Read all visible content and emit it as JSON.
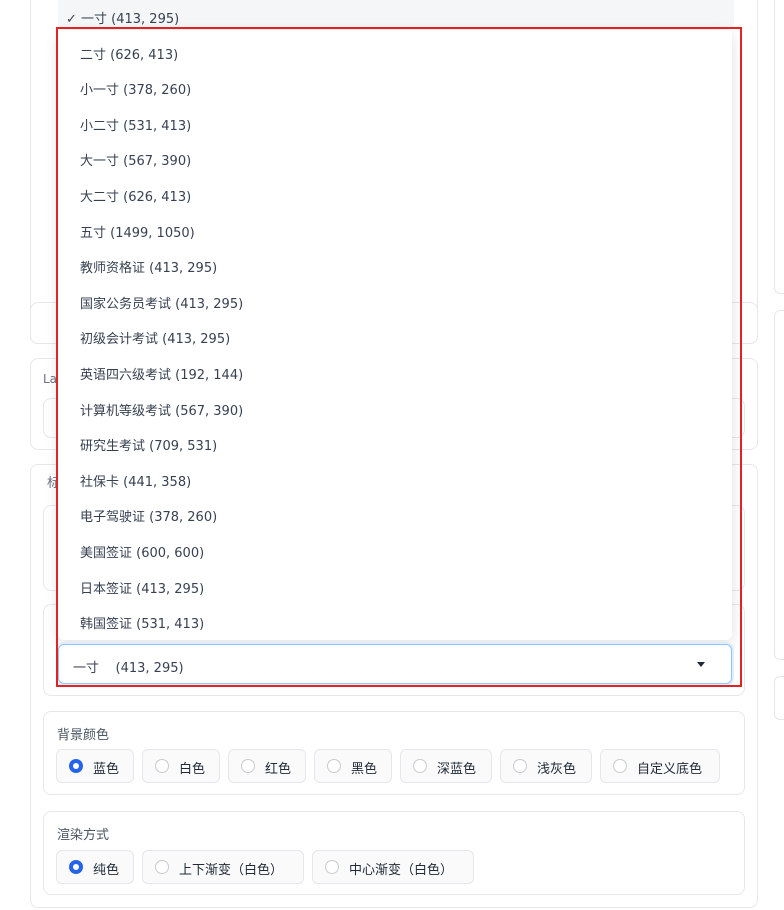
{
  "dropdown": {
    "current_option": "✓ 一寸 (413, 295)",
    "options": [
      "二寸 (626, 413)",
      "小一寸 (378, 260)",
      "小二寸 (531, 413)",
      "大一寸 (567, 390)",
      "大二寸 (626, 413)",
      "五寸 (1499, 1050)",
      "教师资格证 (413, 295)",
      "国家公务员考试 (413, 295)",
      "初级会计考试 (413, 295)",
      "英语四六级考试 (192, 144)",
      "计算机等级考试 (567, 390)",
      "研究生考试 (709, 531)",
      "社保卡 (441, 358)",
      "电子驾驶证 (378, 260)",
      "美国签证 (600, 600)",
      "日本签证 (413, 295)",
      "韩国签证 (531, 413)"
    ],
    "selected_value": "一寸    (413, 295)"
  },
  "side_labels": {
    "layout_label": "La",
    "standard_label": "标"
  },
  "background": {
    "label": "背景颜色",
    "options": [
      "蓝色",
      "白色",
      "红色",
      "黑色",
      "深蓝色",
      "浅灰色",
      "自定义底色"
    ],
    "selected": "蓝色"
  },
  "render": {
    "label": "渲染方式",
    "options": [
      "纯色",
      "上下渐变（白色）",
      "中心渐变（白色）"
    ],
    "selected": "纯色"
  },
  "colors": {
    "accent": "#2563eb",
    "highlight": "#e02424"
  }
}
